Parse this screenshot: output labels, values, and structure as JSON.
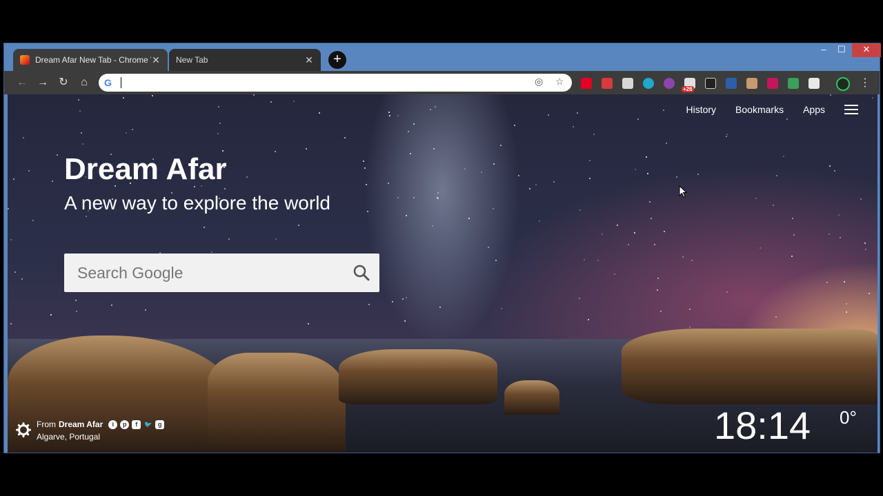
{
  "browser": {
    "tabs": [
      {
        "title": "Dream Afar New Tab - Chrome W",
        "close": "✕"
      },
      {
        "title": "New Tab",
        "close": "✕"
      }
    ],
    "new_tab": "+",
    "window_controls": {
      "minimize": "‒",
      "maximize": "☐",
      "close": "✕"
    },
    "nav": {
      "back": "←",
      "forward": "→",
      "reload": "↻",
      "home": "⌂"
    },
    "omnibox": {
      "value": "",
      "google_icon": "G"
    },
    "extension_badge": "+26",
    "menu": "⋮"
  },
  "page": {
    "top_links": {
      "history": "History",
      "bookmarks": "Bookmarks",
      "apps": "Apps"
    },
    "headline": "Dream Afar",
    "tagline": "A new way to explore the world",
    "search": {
      "placeholder": "Search Google"
    },
    "credit": {
      "prefix": "From",
      "brand": "Dream Afar",
      "location": "Algarve, Portugal"
    },
    "clock": "18:14",
    "temperature": "0°"
  },
  "colors": {
    "accent": "#5a86c0",
    "close": "#c74343"
  }
}
